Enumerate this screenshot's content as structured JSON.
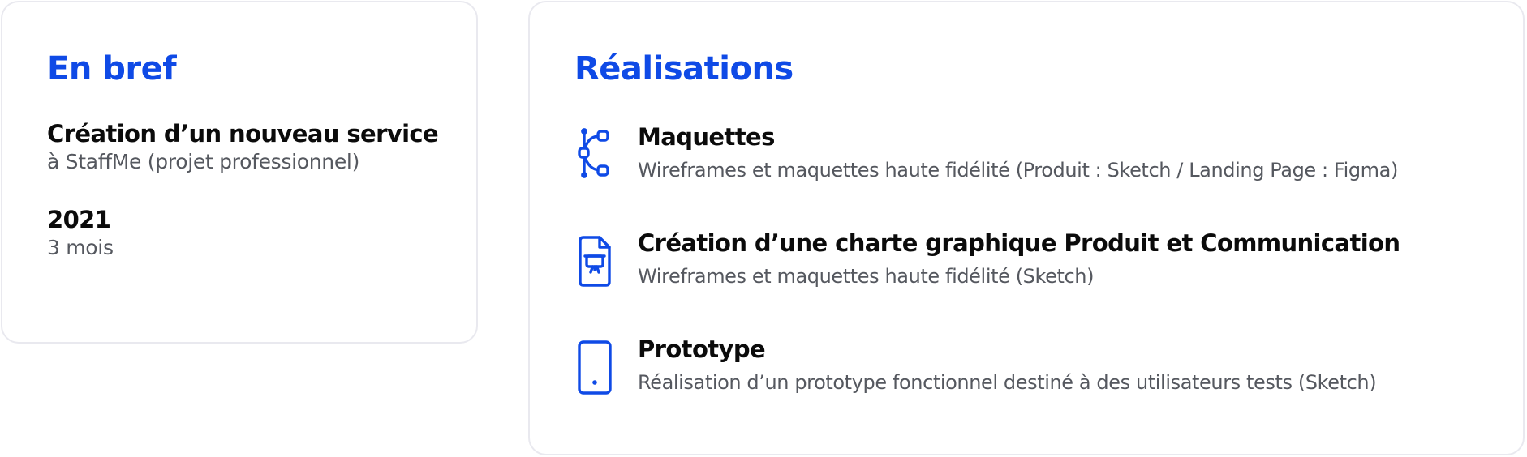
{
  "brief": {
    "title": "En bref",
    "blocks": [
      {
        "main": "Création d’un nouveau service",
        "sub": "à StaffMe (projet professionnel)"
      },
      {
        "main": "2021",
        "sub": "3 mois"
      }
    ]
  },
  "realisations": {
    "title": "Réalisations",
    "items": [
      {
        "icon": "vector-nodes-icon",
        "title": "Maquettes",
        "description": "Wireframes et maquettes haute fidélité (Produit : Sketch / Landing Page : Figma)"
      },
      {
        "icon": "file-presentation-icon",
        "title": "Création d’une charte graphique Produit et Communication",
        "description": "Wireframes et maquettes haute fidélité (Sketch)"
      },
      {
        "icon": "smartphone-icon",
        "title": "Prototype",
        "description": "Réalisation d’un prototype fonctionnel destiné à des utilisateurs tests (Sketch)"
      }
    ]
  },
  "colors": {
    "accent": "#0f4ae6",
    "heading": "#0b0b0b",
    "muted": "#55585f",
    "border": "#e9e9ef"
  }
}
